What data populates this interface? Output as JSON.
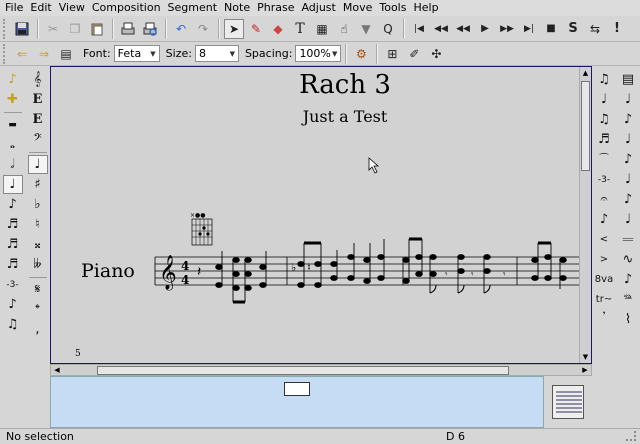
{
  "menu": [
    "File",
    "Edit",
    "View",
    "Composition",
    "Segment",
    "Note",
    "Phrase",
    "Adjust",
    "Move",
    "Tools",
    "Help"
  ],
  "font_toolbar": {
    "font_label": "Font:",
    "font_value": "Feta",
    "size_label": "Size:",
    "size_value": "8",
    "spacing_label": "Spacing:",
    "spacing_value": "100%"
  },
  "score": {
    "title": "Rach 3",
    "subtitle": "Just a Test",
    "instrument": "Piano",
    "time_signature_top": "4",
    "time_signature_bottom": "4",
    "bar_number": "5"
  },
  "status": {
    "selection": "No selection",
    "position": "D 6"
  },
  "icons": {
    "toolbar1": [
      "save-icon",
      "cut-icon",
      "copy-icon",
      "paste-icon",
      "print-icon",
      "print-preview-icon",
      "undo-icon",
      "redo-icon",
      "select-arrow-icon",
      "draw-pencil-icon",
      "erase-icon",
      "text-tool-icon",
      "guitar-chord-icon",
      "fingering-icon",
      "filter-icon",
      "search-icon",
      "rewind-to-start-icon",
      "rewind-icon",
      "fast-rewind-icon",
      "play-icon",
      "fast-forward-icon",
      "forward-to-end-icon",
      "stop-icon",
      "solo-icon",
      "loop-icon",
      "panic-icon"
    ],
    "toolbar2": [
      "move-left-icon",
      "move-right-icon",
      "sheet-icon"
    ],
    "toolbar2_right": [
      "layout-icon",
      "insert-icon",
      "overlay-icon",
      "symbol-icon"
    ],
    "left_col1": [
      "clef-icon",
      "note-add-icon",
      "rest-icon",
      "whole-note-icon",
      "half-note-icon",
      "quarter-note-icon",
      "eighth-note-icon",
      "sixteenth-note-icon",
      "thirty-second-note-icon",
      "sixty-fourth-note-icon",
      "triplet-icon",
      "grace-note-icon",
      "chord-note-icon"
    ],
    "left_col2": [
      "treble-clef-icon",
      "e-icon",
      "e-flat-icon",
      "bass-clef-icon",
      "dotted-note-icon",
      "sharp-icon",
      "flat-icon",
      "natural-icon",
      "double-sharp-icon",
      "double-flat-icon",
      "segno-icon",
      "coda-icon",
      "comma-icon"
    ],
    "right_col1": [
      "beam-icon",
      "quarter-note-group-icon",
      "eighth-group-icon",
      "triplet-group-icon",
      "tie-icon",
      "slur-icon",
      "fermata-icon",
      "tuplet-icon",
      "crescendo-icon",
      "decrescendo-icon",
      "octave-up-icon",
      "trill-icon",
      "sustain-icon"
    ],
    "right_col2": [
      "sheet-layout-icon",
      "accent-icon",
      "staccato-icon",
      "tenuto-icon",
      "marcato-icon",
      "sforzando-icon",
      "upbow-icon",
      "downbow-icon",
      "turn-icon",
      "mordent-icon",
      "grace-group-icon",
      "pedal-icon",
      "arpeggio-icon"
    ]
  }
}
